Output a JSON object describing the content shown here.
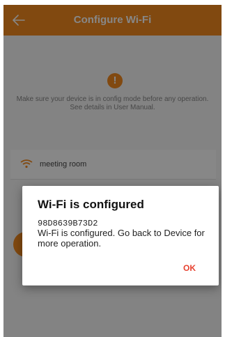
{
  "header": {
    "title": "Configure Wi-Fi"
  },
  "instructions": {
    "warning_symbol": "!",
    "line1": "Make sure your device is in config mode before any operation.",
    "line2": "See details in User Manual."
  },
  "wifi": {
    "ssid": "meeting room"
  },
  "dialog": {
    "title": "Wi-Fi is configured",
    "device_id": "98D8639B73D2",
    "message": "Wi-Fi is configured. Go back to Device for more operation.",
    "ok_label": "OK"
  },
  "colors": {
    "accent": "#f48a1f",
    "ok": "#e7412f"
  }
}
